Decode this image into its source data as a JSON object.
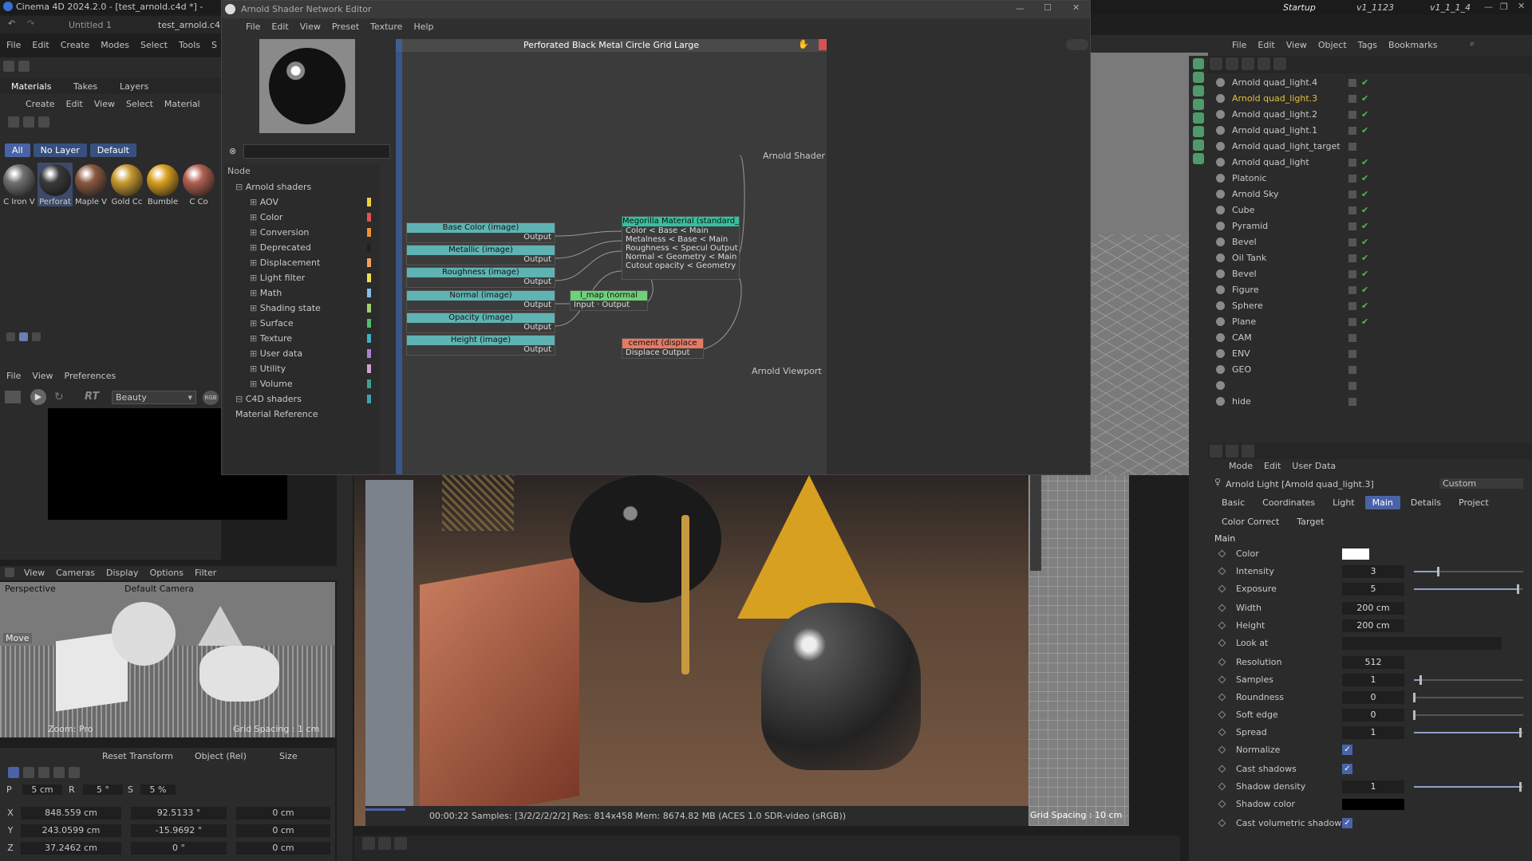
{
  "c4d": {
    "title": "Cinema 4D 2024.2.0 - [test_arnold.c4d *] -",
    "doc_tab": "Untitled 1",
    "doc_tab2": "test_arnold.c4",
    "menu": [
      "File",
      "Edit",
      "Create",
      "Modes",
      "Select",
      "Tools",
      "S"
    ],
    "top_right_tabs": [
      "Startup",
      "v1_1123",
      "v1_1_1_4"
    ],
    "om_menu": [
      "File",
      "Edit",
      "View",
      "Object",
      "Tags",
      "Bookmarks"
    ]
  },
  "materials": {
    "tabs": [
      "Materials",
      "Takes",
      "Layers"
    ],
    "menu": [
      "Create",
      "Edit",
      "View",
      "Select",
      "Material"
    ],
    "filters": [
      "All",
      "No Layer",
      "Default"
    ],
    "swatches": [
      {
        "label": "C Iron V",
        "color": "#707070"
      },
      {
        "label": "Perforat",
        "color": "#3a3a3a"
      },
      {
        "label": "Maple V",
        "color": "#8a5a40"
      },
      {
        "label": "Gold Cc",
        "color": "#c89a30"
      },
      {
        "label": "Bumble",
        "color": "#d8a020"
      },
      {
        "label": "C Co",
        "color": "#b06050"
      }
    ]
  },
  "render": {
    "menu": [
      "File",
      "View",
      "Preferences"
    ],
    "preset": "Beauty",
    "rt": "RT",
    "rgb": "RGB"
  },
  "viewport_small": {
    "menu": [
      "View",
      "Cameras",
      "Display",
      "Options",
      "Filter"
    ],
    "label": "Perspective",
    "camera": "Default Camera",
    "move": "Move",
    "footer_left": "Zoom: Pro",
    "footer_right": "Grid Spacing : 1 cm"
  },
  "coords": {
    "reset": "Reset Transform",
    "mode": "Object (Rel)",
    "size": "Size",
    "p": "P",
    "p_val": "5 cm",
    "r": "R",
    "r_val": "5 °",
    "s": "S",
    "s_val": "5 %",
    "rows": [
      {
        "axis": "X",
        "pos": "848.559 cm",
        "rot": "92.5133 °",
        "size": "0 cm"
      },
      {
        "axis": "Y",
        "pos": "243.0599 cm",
        "rot": "-15.9692 °",
        "size": "0 cm"
      },
      {
        "axis": "Z",
        "pos": "37.2462 cm",
        "rot": "0 °",
        "size": "0 cm"
      }
    ]
  },
  "shader_editor": {
    "title": "Arnold Shader Network Editor",
    "menu": [
      "File",
      "Edit",
      "View",
      "Preset",
      "Texture",
      "Help"
    ],
    "node_header": "Node",
    "categories": [
      {
        "name": "Arnold shaders",
        "color": ""
      },
      {
        "name": "AOV",
        "color": "#f0d040"
      },
      {
        "name": "Color",
        "color": "#e85050"
      },
      {
        "name": "Conversion",
        "color": "#f09030"
      },
      {
        "name": "Deprecated",
        "color": "#222222"
      },
      {
        "name": "Displacement",
        "color": "#f0a060"
      },
      {
        "name": "Light filter",
        "color": "#f0e050"
      },
      {
        "name": "Math",
        "color": "#80c0f0"
      },
      {
        "name": "Shading state",
        "color": "#a0d070"
      },
      {
        "name": "Surface",
        "color": "#50c070"
      },
      {
        "name": "Texture",
        "color": "#40b0c0"
      },
      {
        "name": "User data",
        "color": "#b080d0"
      },
      {
        "name": "Utility",
        "color": "#d0a0d0"
      },
      {
        "name": "Volume",
        "color": "#40a090"
      },
      {
        "name": "C4D shaders",
        "color": "#40a0b0"
      },
      {
        "name": "Material Reference",
        "color": ""
      }
    ],
    "graph_title": "Perforated Black Metal Circle Grid Large",
    "nodes": {
      "base": "Base Color (image)",
      "metal": "Metallic (image)",
      "rough": "Roughness (image)",
      "normal": "Normal (image)",
      "opacity": "Opacity (image)",
      "height": "Height (image)",
      "output": "Output",
      "normal_map": "l_map (normal",
      "normal_map_io": "Input · Output",
      "material": "Megorilla Material (standard_s",
      "mat_rows": [
        "Color < Base < Main",
        "Metalness < Base < Main",
        "Roughness < Specul Output",
        "Normal < Geometry < Main",
        "Cutout opacity < Geometry"
      ],
      "disp": "cement (displace",
      "disp_io": "Displace Output",
      "arnold_shader": "Arnold Shader",
      "arnold_viewport": "Arnold Viewport"
    }
  },
  "render_view": {
    "status": "00:00:22  Samples: [3/2/2/2/2/2]  Res: 814x458  Mem: 8674.82 MB  (ACES 1.0 SDR-video (sRGB))",
    "grid": "Grid Spacing : 10 cm"
  },
  "object_manager": {
    "objects": [
      {
        "name": "Arnold quad_light.4",
        "color": "#c8c8c8",
        "highlight": false
      },
      {
        "name": "Arnold quad_light.3",
        "color": "#e0c040",
        "highlight": true
      },
      {
        "name": "Arnold quad_light.2",
        "color": "#c8c8c8",
        "highlight": false
      },
      {
        "name": "Arnold quad_light.1",
        "color": "#c8c8c8",
        "highlight": false
      },
      {
        "name": "Arnold quad_light_target",
        "color": "#c8c8c8",
        "highlight": false
      },
      {
        "name": "Arnold quad_light",
        "color": "#c8c8c8",
        "highlight": false
      },
      {
        "name": "Platonic",
        "color": "#c8c8c8",
        "highlight": false
      },
      {
        "name": "Arnold Sky",
        "color": "#c8c8c8",
        "highlight": false
      },
      {
        "name": "Cube",
        "color": "#c8c8c8",
        "highlight": false
      },
      {
        "name": "Pyramid",
        "color": "#c8c8c8",
        "highlight": false
      },
      {
        "name": "Bevel",
        "color": "#c8c8c8",
        "highlight": false
      },
      {
        "name": "Oil Tank",
        "color": "#c8c8c8",
        "highlight": false
      },
      {
        "name": "Bevel",
        "color": "#c8c8c8",
        "highlight": false
      },
      {
        "name": "Figure",
        "color": "#c8c8c8",
        "highlight": false
      },
      {
        "name": "Sphere",
        "color": "#c8c8c8",
        "highlight": false
      },
      {
        "name": "Plane",
        "color": "#c8c8c8",
        "highlight": false
      },
      {
        "name": "CAM",
        "color": "#c8c8c8",
        "highlight": false
      },
      {
        "name": "ENV",
        "color": "#c8c8c8",
        "highlight": false
      },
      {
        "name": "GEO",
        "color": "#c8c8c8",
        "highlight": false
      },
      {
        "name": "",
        "color": "#c8c8c8",
        "highlight": false
      },
      {
        "name": "hide",
        "color": "#c8c8c8",
        "highlight": false
      }
    ]
  },
  "attributes": {
    "menu": [
      "Mode",
      "Edit",
      "User Data"
    ],
    "title": "Arnold Light [Arnold quad_light.3]",
    "preset": "Custom",
    "tabs": [
      "Basic",
      "Coordinates",
      "Light",
      "Main",
      "Details",
      "Project"
    ],
    "active_tab": "Main",
    "tabs2": [
      "Color Correct",
      "Target"
    ],
    "section": "Main",
    "props": [
      {
        "label": "Color",
        "value": "",
        "type": "color"
      },
      {
        "label": "Intensity",
        "value": "3",
        "slider": 0.22
      },
      {
        "label": "Exposure",
        "value": "5",
        "slider": 0.95
      },
      {
        "label": "Width",
        "value": "200 cm"
      },
      {
        "label": "Height",
        "value": "200 cm"
      },
      {
        "label": "Look at",
        "value": "",
        "type": "link"
      },
      {
        "label": "Resolution",
        "value": "512"
      },
      {
        "label": "Samples",
        "value": "1",
        "slider": 0.06
      },
      {
        "label": "Roundness",
        "value": "0",
        "slider": 0.0
      },
      {
        "label": "Soft edge",
        "value": "0",
        "slider": 0.0
      },
      {
        "label": "Spread",
        "value": "1",
        "slider": 0.97
      },
      {
        "label": "Normalize",
        "value": "",
        "type": "check"
      },
      {
        "label": "Cast shadows",
        "value": "",
        "type": "check"
      },
      {
        "label": "Shadow density",
        "value": "1",
        "slider": 0.97
      },
      {
        "label": "Shadow color",
        "value": "",
        "type": "dark"
      },
      {
        "label": "Cast volumetric shadows",
        "value": "",
        "type": "check"
      }
    ]
  }
}
